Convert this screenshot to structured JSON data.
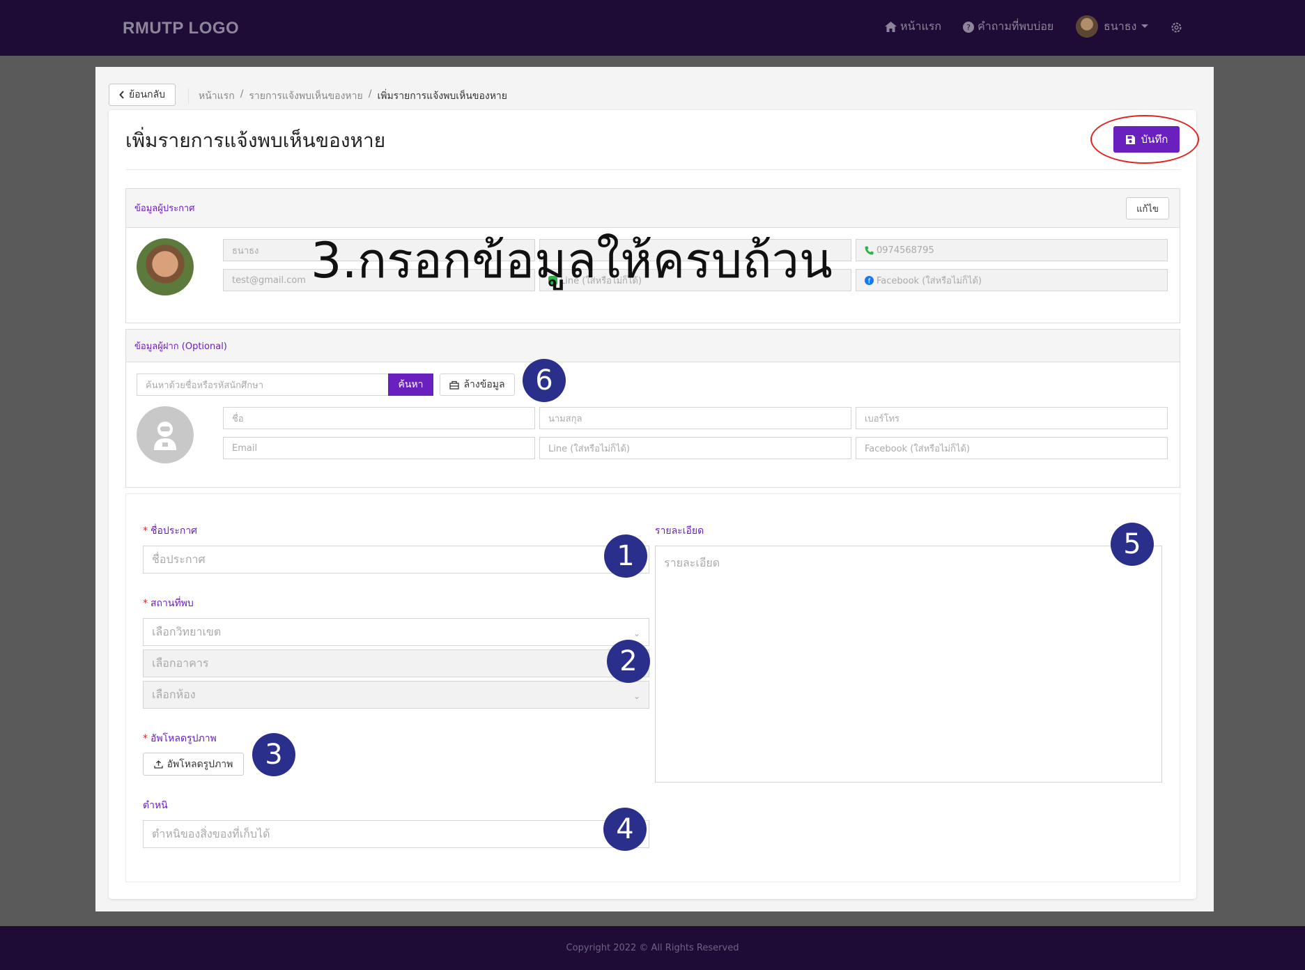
{
  "header": {
    "logo": "RMUTP LOGO",
    "nav_home": "หน้าแรก",
    "nav_faq": "คำถามที่พบบ่อย",
    "nav_user": "ธนาธง"
  },
  "page": {
    "back_label": "ย้อนกลับ",
    "breadcrumb": [
      "หน้าแรก",
      "รายการแจ้งพบเห็นของหาย",
      "เพิ่มรายการแจ้งพบเห็นของหาย"
    ],
    "title": "เพิ่มรายการแจ้งพบเห็นของหาย",
    "save_label": "บันทึก"
  },
  "announcer": {
    "heading": "ข้อมูลผู้ประกาศ",
    "edit_label": "แก้ไข",
    "first_name": "ธนาธง",
    "phone": "0974568795",
    "email": "test@gmail.com",
    "line_placeholder": "Line (ใส่หรือไม่ก็ได้)",
    "facebook_placeholder": "Facebook (ใส่หรือไม่ก็ได้)"
  },
  "depositor": {
    "heading": "ข้อมูลผู้ฝาก (Optional)",
    "search_placeholder": "ค้นหาด้วยชื่อหรือรหัสนักศึกษา",
    "search_label": "ค้นหา",
    "clear_label": "ล้างข้อมูล",
    "name_placeholder": "ชื่อ",
    "surname_placeholder": "นามสกุล",
    "phone_placeholder": "เบอร์โทร",
    "email_placeholder": "Email",
    "line_placeholder": "Line (ใส่หรือไม่ก็ได้)",
    "facebook_placeholder": "Facebook (ใส่หรือไม่ก็ได้)"
  },
  "form": {
    "title_label": "ชื่อประกาศ",
    "title_placeholder": "ชื่อประกาศ",
    "location_label": "สถานที่พบ",
    "campus_placeholder": "เลือกวิทยาเขต",
    "building_placeholder": "เลือกอาคาร",
    "room_placeholder": "เลือกห้อง",
    "upload_label": "อัพโหลดรูปภาพ",
    "upload_button": "อัพโหลดรูปภาพ",
    "defect_label": "ตำหนิ",
    "defect_placeholder": "ตำหนิของสิ่งของที่เก็บได้",
    "detail_label": "รายละเอียด",
    "detail_placeholder": "รายละเอียด"
  },
  "annotations": {
    "note": "3.กรอกข้อมูลให้ครบถ้วน",
    "badges": [
      "1",
      "2",
      "3",
      "4",
      "5",
      "6"
    ]
  },
  "footer": {
    "text": "Copyright 2022 © All Rights Reserved"
  },
  "colors": {
    "brand": "#6a1fbf",
    "header_bg": "#1e0c36",
    "annotation_badge": "#2a2f8c",
    "annotation_ring": "#e32222"
  }
}
